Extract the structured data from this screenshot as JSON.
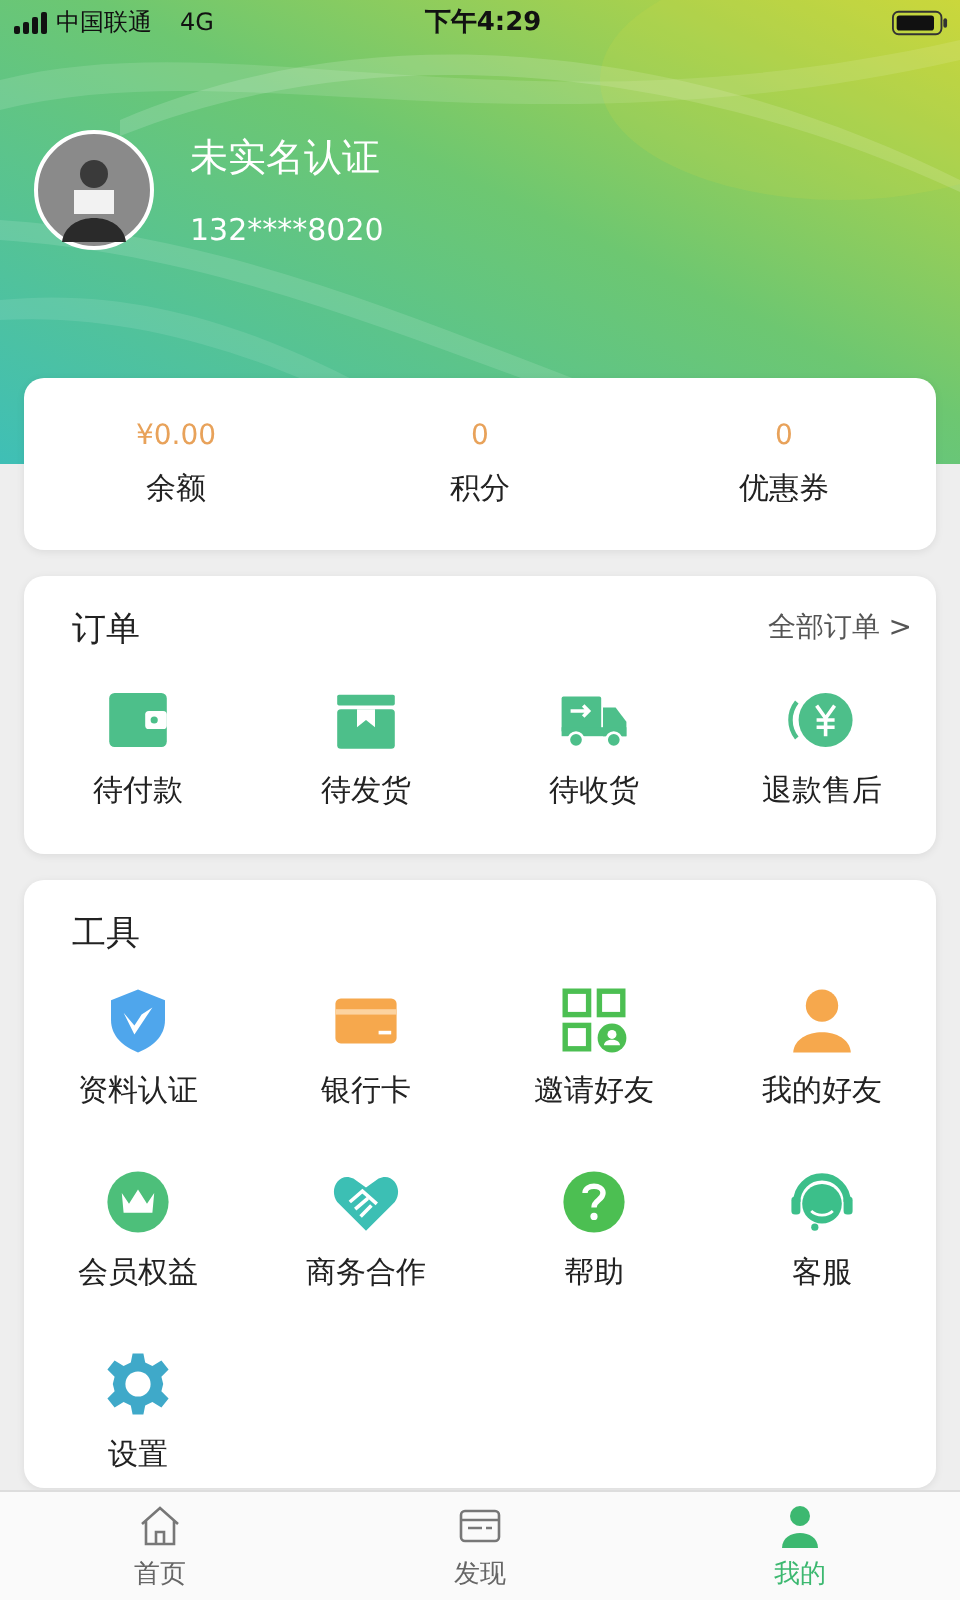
{
  "status_bar": {
    "carrier": "中国联通",
    "network": "4G",
    "time": "下午4:29"
  },
  "profile": {
    "name": "未实名认证",
    "phone": "132****8020"
  },
  "stats": [
    {
      "value": "¥0.00",
      "label": "余额"
    },
    {
      "value": "0",
      "label": "积分"
    },
    {
      "value": "0",
      "label": "优惠券"
    }
  ],
  "orders": {
    "title": "订单",
    "all_link": "全部订单",
    "chevron": ">",
    "items": [
      {
        "label": "待付款"
      },
      {
        "label": "待发货"
      },
      {
        "label": "待收货"
      },
      {
        "label": "退款售后"
      }
    ]
  },
  "tools": {
    "title": "工具",
    "items": [
      {
        "label": "资料认证"
      },
      {
        "label": "银行卡"
      },
      {
        "label": "邀请好友"
      },
      {
        "label": "我的好友"
      },
      {
        "label": "会员权益"
      },
      {
        "label": "商务合作"
      },
      {
        "label": "帮助"
      },
      {
        "label": "客服"
      },
      {
        "label": "设置"
      }
    ]
  },
  "tab_bar": [
    {
      "label": "首页",
      "selected": false
    },
    {
      "label": "发现",
      "selected": false
    },
    {
      "label": "我的",
      "selected": true
    }
  ]
}
